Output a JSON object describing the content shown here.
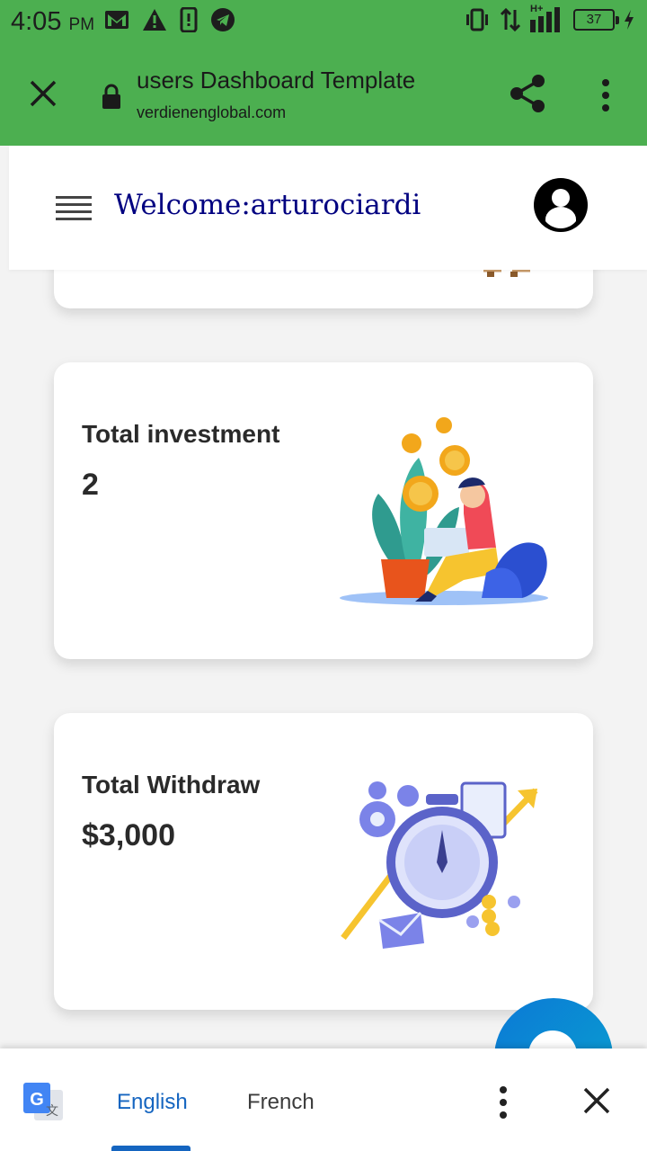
{
  "status_bar": {
    "time": "4:05",
    "ampm": "PM",
    "network": "H+",
    "battery": "37"
  },
  "browser": {
    "page_title": "users Dashboard Template",
    "url": "verdienenglobal.com"
  },
  "site_header": {
    "welcome": "Welcome:arturociardi"
  },
  "cards": [
    {
      "label": "Total investment",
      "value": "2"
    },
    {
      "label": "Total Withdraw",
      "value": "$3,000"
    }
  ],
  "translate_bar": {
    "languages": [
      "English",
      "French"
    ],
    "selected": "English"
  },
  "colors": {
    "chrome_green": "#4caf50",
    "welcome_navy": "#000080",
    "translate_blue": "#1565c0"
  }
}
